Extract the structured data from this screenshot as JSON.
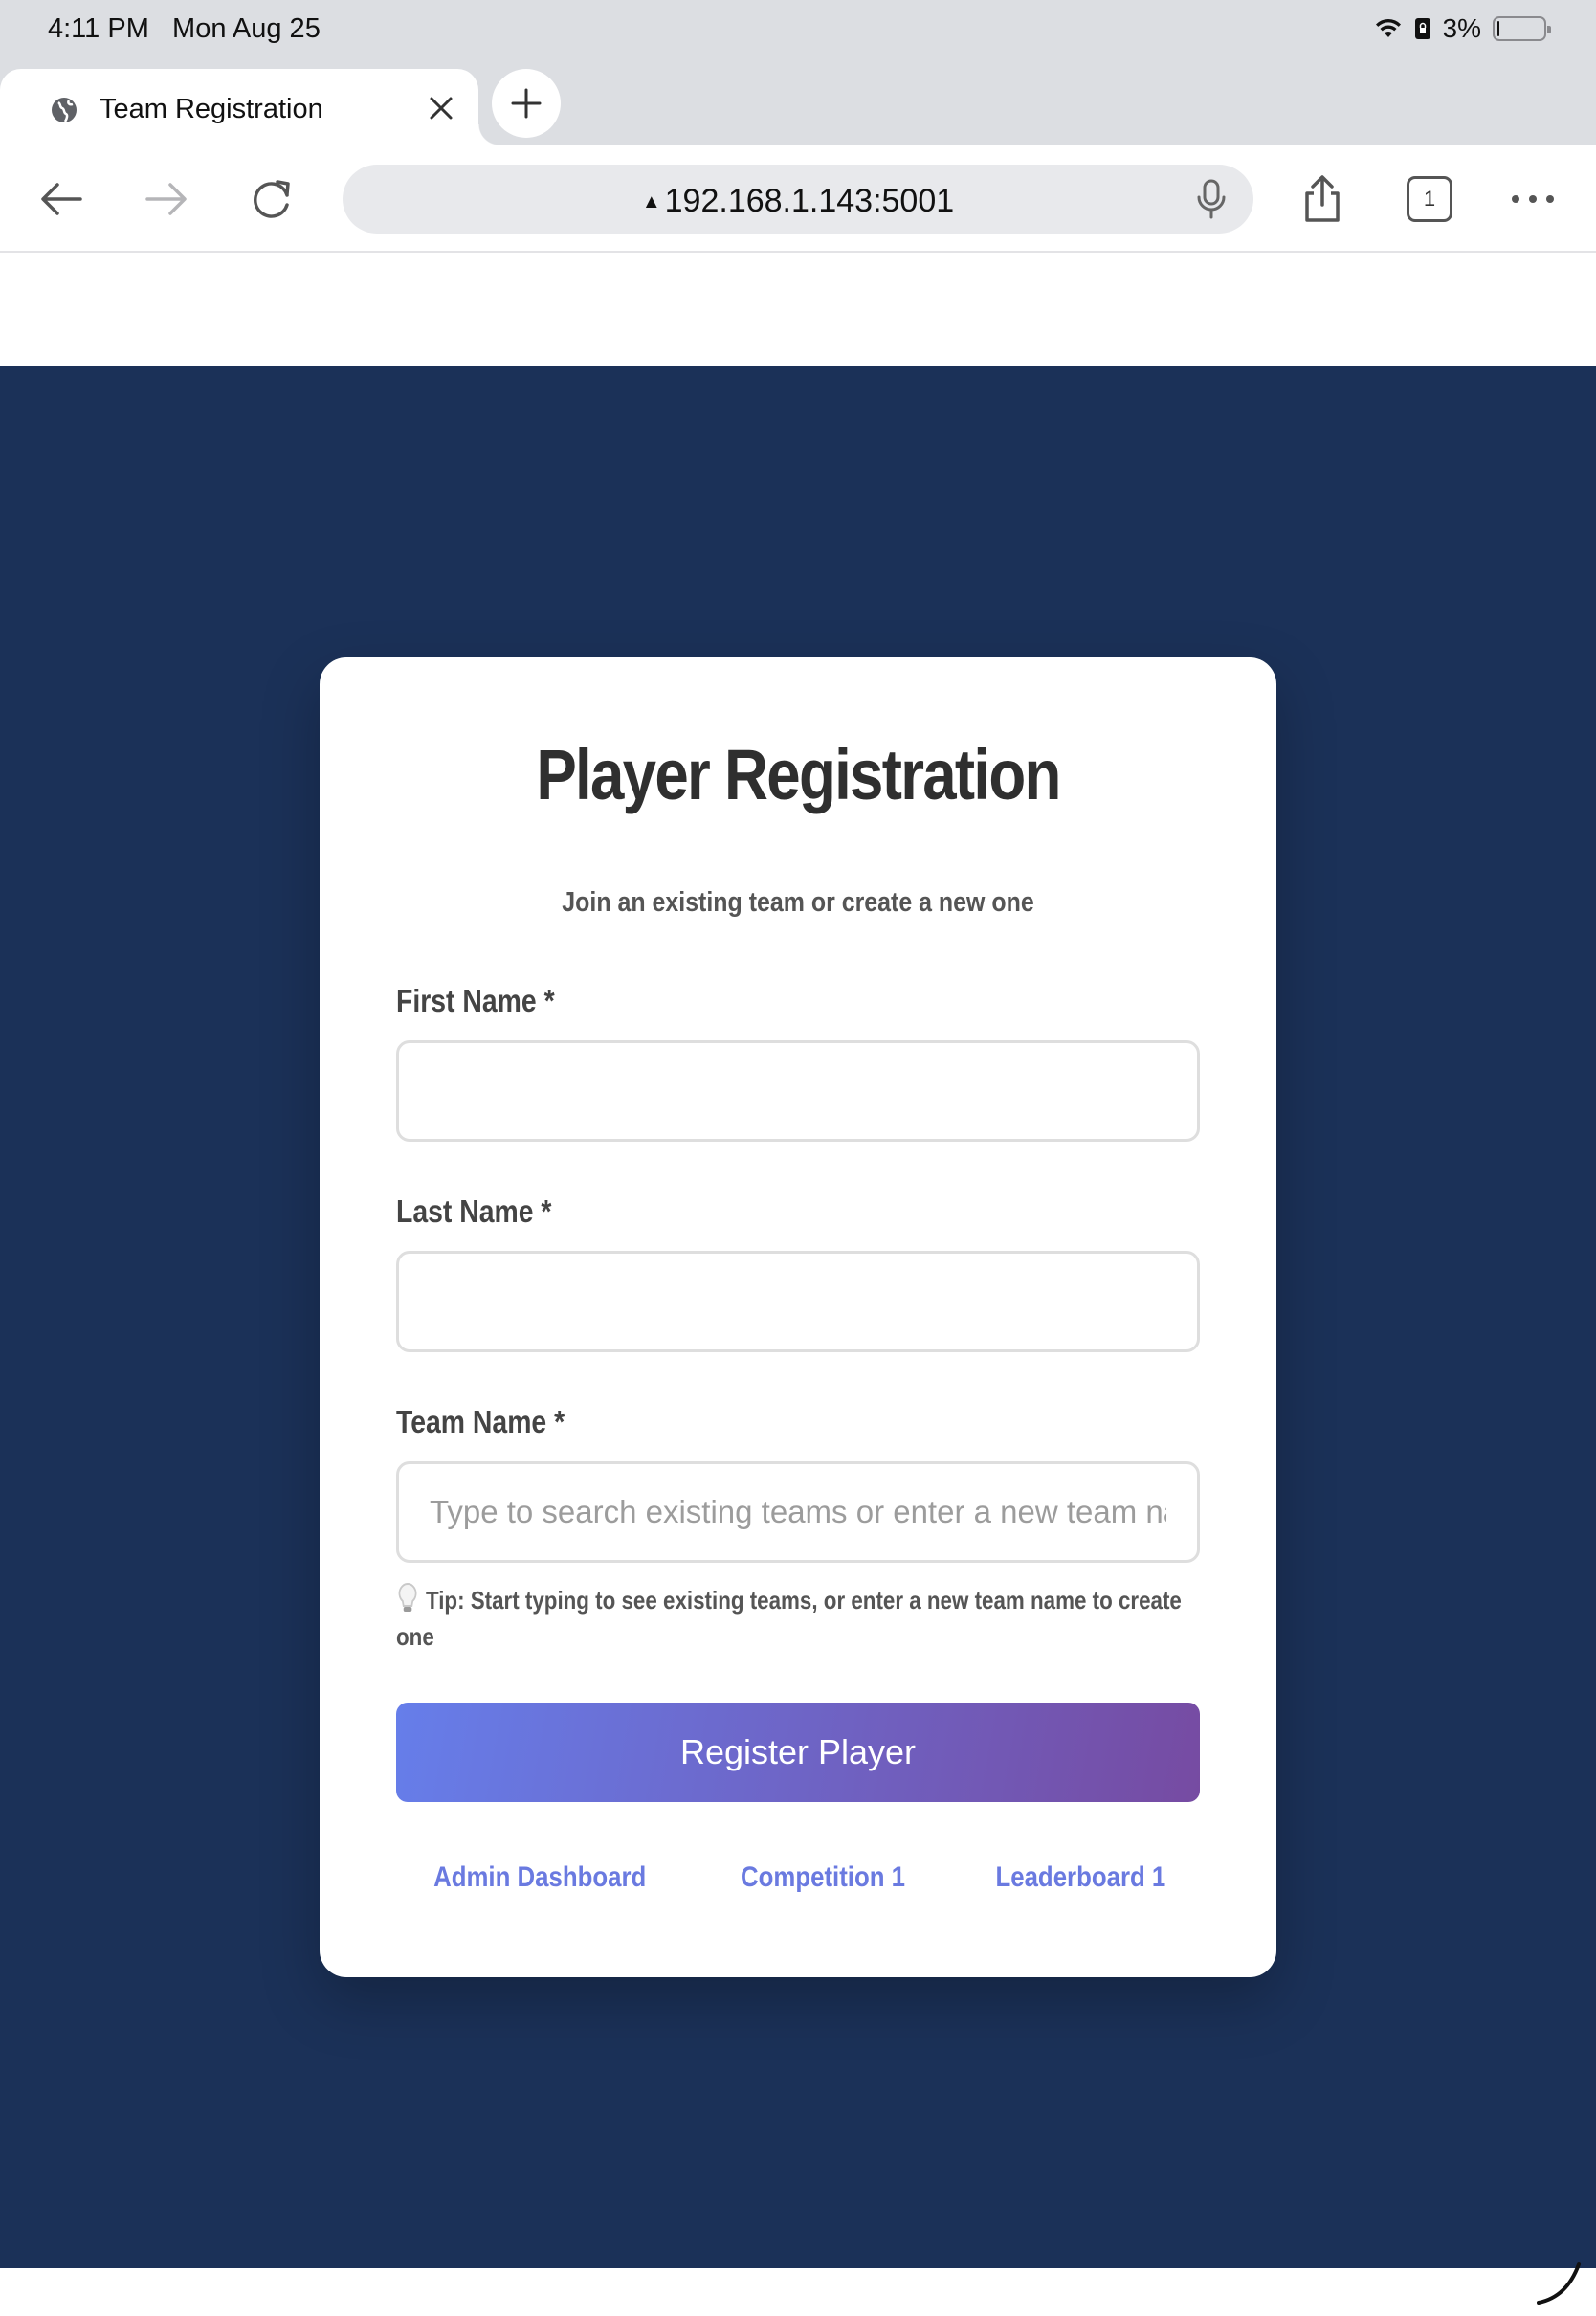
{
  "status_bar": {
    "time": "4:11 PM",
    "date": "Mon Aug 25",
    "battery_text": "3%",
    "battery_level": 0.03
  },
  "browser": {
    "tab_title": "Team Registration",
    "url": "192.168.1.143:5001",
    "tab_count": "1",
    "icons": {
      "back": "back-arrow-icon",
      "forward": "forward-arrow-icon",
      "reload": "reload-icon",
      "share": "share-icon",
      "more": "more-icon"
    }
  },
  "form": {
    "title": "Player Registration",
    "subtitle": "Join an existing team or create a new one",
    "first_name_label": "First Name *",
    "first_name_value": "",
    "last_name_label": "Last Name *",
    "last_name_value": "",
    "team_name_label": "Team Name *",
    "team_name_placeholder": "Type to search existing teams or enter a new team name",
    "tip": "Tip: Start typing to see existing teams, or enter a new team name to create one",
    "submit_label": "Register Player"
  },
  "links": {
    "admin": "Admin Dashboard",
    "competition": "Competition 1",
    "leaderboard": "Leaderboard 1"
  },
  "colors": {
    "page_background": "#1b3158",
    "button_gradient_start": "#667eea",
    "button_gradient_end": "#764ba2",
    "link": "#6a7ae0"
  }
}
